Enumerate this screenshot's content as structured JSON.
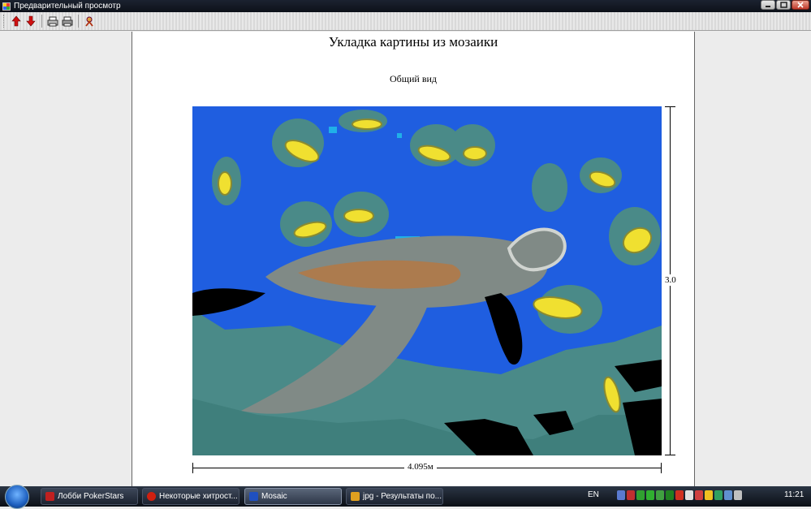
{
  "window": {
    "title": "Предварительный просмотр"
  },
  "toolbar": {
    "buttons": [
      {
        "name": "arrow-up-icon",
        "color": "#d01010"
      },
      {
        "name": "arrow-down-icon",
        "color": "#d01010"
      },
      {
        "name": "print-preview-icon",
        "color": "#444444"
      },
      {
        "name": "printer-icon",
        "color": "#444444"
      },
      {
        "name": "exit-icon",
        "color": "#b03010"
      }
    ]
  },
  "document": {
    "title": "Укладка картины из мозаики",
    "subtitle": "Общий вид",
    "width_label": "4.095м",
    "height_label": "3.0"
  },
  "mosaic_colors": {
    "water": "#1f5ee0",
    "shell": "#808a86",
    "teal": "#4a8a88",
    "yellow": "#f0e030",
    "orange": "#d07020",
    "black": "#000000",
    "light": "#d0d4d0",
    "cyan": "#20b0e8"
  },
  "taskbar": {
    "tasks": [
      {
        "label": "Лобби PokerStars",
        "icon_color": "#c02020"
      },
      {
        "label": "Некоторые хитрост...",
        "icon_color": "#d02010"
      },
      {
        "label": "Mosaic",
        "icon_color": "#2050c0"
      },
      {
        "label": "jpg - Результаты по...",
        "icon_color": "#e0a020"
      }
    ],
    "language": "EN",
    "clock": "11:21"
  }
}
